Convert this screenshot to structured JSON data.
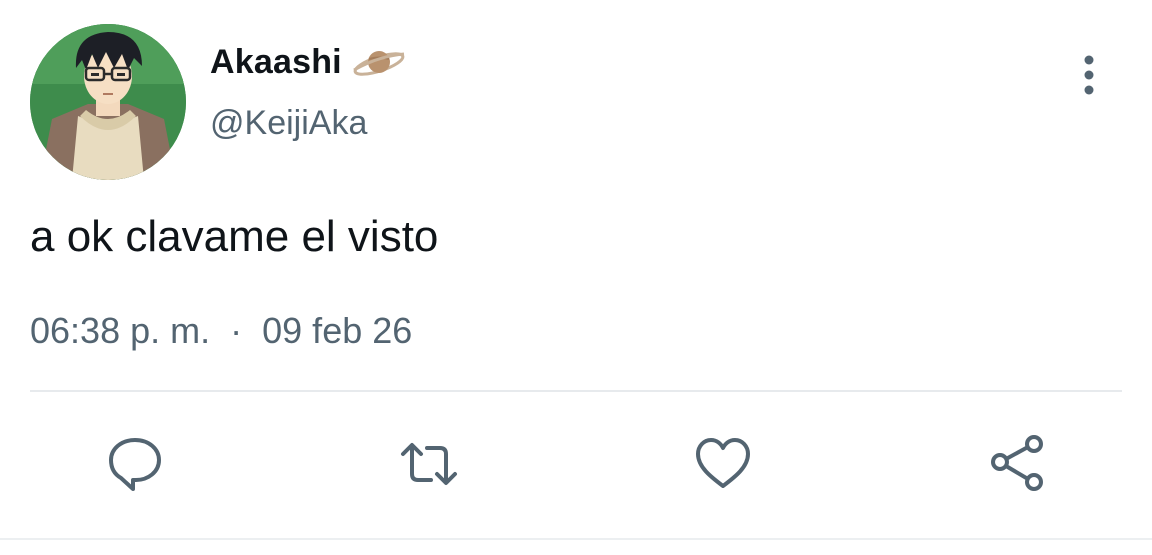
{
  "tweet": {
    "display_name": "Akaashi",
    "name_emoji": "planet-icon",
    "handle": "@KeijiAka",
    "text": "a ok clavame el visto",
    "time": "06:38 p. m.",
    "separator": "·",
    "date": "09 feb 26"
  },
  "actions": [
    {
      "icon": "reply-icon"
    },
    {
      "icon": "retweet-icon"
    },
    {
      "icon": "like-icon"
    },
    {
      "icon": "share-icon"
    }
  ],
  "colors": {
    "primary_text": "#0f1419",
    "secondary_text": "#536471",
    "divider": "#e7eaed",
    "avatar_background": "#3f8f4f"
  }
}
